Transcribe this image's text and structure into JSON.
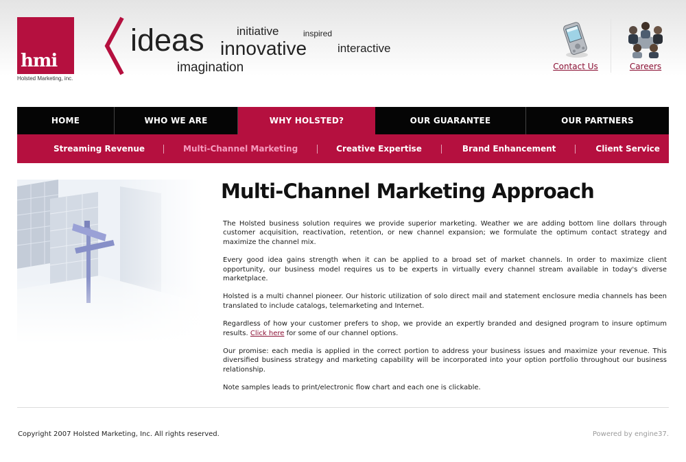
{
  "brand": {
    "logo_text": "hmi",
    "company_name": "Holsted Marketing, inc.",
    "accent_color": "#b5103f"
  },
  "tagline_words": {
    "ideas": "ideas",
    "initiative": "initiative",
    "inspired": "inspired",
    "innovative": "innovative",
    "interactive": "interactive",
    "imagination": "imagination"
  },
  "header_links": [
    {
      "label": "Contact Us",
      "icon": "pda-handheld-icon"
    },
    {
      "label": "Careers",
      "icon": "meeting-people-icon"
    }
  ],
  "nav": {
    "tabs": [
      {
        "label": "HOME",
        "active": false
      },
      {
        "label": "WHO WE ARE",
        "active": false
      },
      {
        "label": "WHY HOLSTED?",
        "active": true
      },
      {
        "label": "OUR GUARANTEE",
        "active": false
      },
      {
        "label": "OUR PARTNERS",
        "active": false
      }
    ],
    "subnav": [
      {
        "label": "Streaming Revenue",
        "active": false
      },
      {
        "label": "Multi-Channel Marketing",
        "active": true
      },
      {
        "label": "Creative Expertise",
        "active": false
      },
      {
        "label": "Brand Enhancement",
        "active": false
      },
      {
        "label": "Client Service",
        "active": false
      }
    ]
  },
  "main": {
    "title": "Multi-Channel Marketing Approach",
    "paragraphs": [
      "The Holsted business solution requires we provide superior marketing. Weather we are adding bottom line dollars through customer acquisition, reactivation, retention, or new channel expansion; we formulate the optimum contact strategy and maximize the channel mix.",
      "Every good idea gains strength when it can be applied to a broad set of market channels. In order to maximize client opportunity, our business model requires us to be experts in virtually every channel stream available in today's diverse marketplace.",
      "Holsted is a multi channel pioneer. Our historic utilization of solo direct mail and statement enclosure media channels has been translated to include catalogs, telemarketing and Internet."
    ],
    "p4_before": "Regardless of how your customer prefers to shop, we provide an expertly branded and designed program to insure optimum results.",
    "p4_link": "Click here",
    "p4_after": "for some of our channel options.",
    "paragraphs_after": [
      "Our promise: each media is applied in the correct portion to address your business issues and maximize your revenue. This diversified business strategy and marketing capability will be incorporated into your option portfolio throughout our business relationship.",
      "Note samples leads to print/electronic flow chart and each one is clickable."
    ]
  },
  "footer": {
    "copyright": "Copyright 2007 Holsted Marketing, Inc. All rights reserved.",
    "powered_by": "Powered by engine37."
  }
}
